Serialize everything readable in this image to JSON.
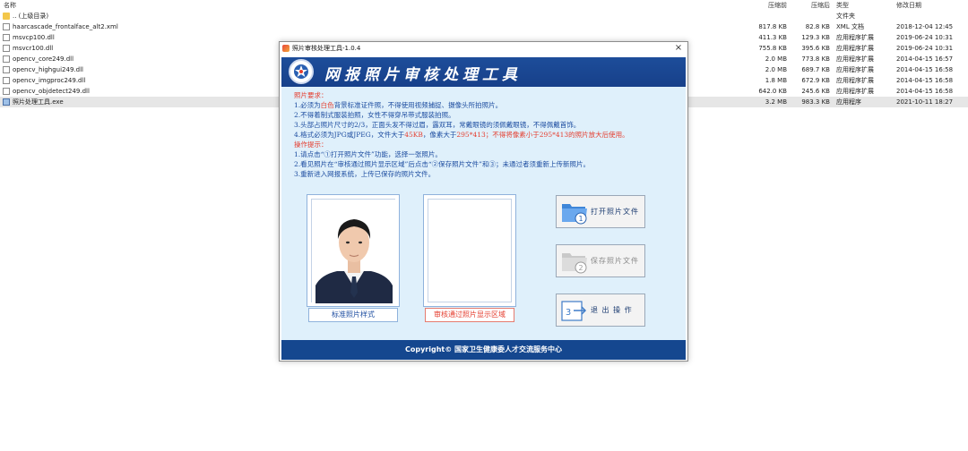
{
  "filelist": {
    "headers": {
      "name": "名称",
      "compressed": "压缩前",
      "original": "压缩后",
      "type": "类型",
      "modified": "修改日期"
    },
    "rows": [
      {
        "name": ".. (上级目录)",
        "compressed": "",
        "original": "",
        "type": "文件夹",
        "modified": "",
        "icon": "folder"
      },
      {
        "name": "haarcascade_frontalface_alt2.xml",
        "compressed": "817.8 KB",
        "original": "82.8 KB",
        "type": "XML 文档",
        "modified": "2018-12-04 12:45",
        "icon": "doc"
      },
      {
        "name": "msvcp100.dll",
        "compressed": "411.3 KB",
        "original": "129.3 KB",
        "type": "应用程序扩展",
        "modified": "2019-06-24 10:31",
        "icon": "doc"
      },
      {
        "name": "msvcr100.dll",
        "compressed": "755.8 KB",
        "original": "395.6 KB",
        "type": "应用程序扩展",
        "modified": "2019-06-24 10:31",
        "icon": "doc"
      },
      {
        "name": "opencv_core249.dll",
        "compressed": "2.0 MB",
        "original": "773.8 KB",
        "type": "应用程序扩展",
        "modified": "2014-04-15 16:57",
        "icon": "doc"
      },
      {
        "name": "opencv_highgui249.dll",
        "compressed": "2.0 MB",
        "original": "689.7 KB",
        "type": "应用程序扩展",
        "modified": "2014-04-15 16:58",
        "icon": "doc"
      },
      {
        "name": "opencv_imgproc249.dll",
        "compressed": "1.8 MB",
        "original": "672.9 KB",
        "type": "应用程序扩展",
        "modified": "2014-04-15 16:58",
        "icon": "doc"
      },
      {
        "name": "opencv_objdetect249.dll",
        "compressed": "642.0 KB",
        "original": "245.6 KB",
        "type": "应用程序扩展",
        "modified": "2014-04-15 16:58",
        "icon": "doc"
      },
      {
        "name": "照片处理工具.exe",
        "compressed": "3.2 MB",
        "original": "983.3 KB",
        "type": "应用程序",
        "modified": "2021-10-11 18:27",
        "icon": "exe",
        "selected": true
      }
    ]
  },
  "dialog": {
    "title": "照片审核处理工具-1.0.4",
    "close_glyph": "×",
    "banner_title": "网报照片审核处理工具",
    "instructions": {
      "req_heading": "照片要求：",
      "r1a": "1.必须为",
      "r1b": "白色",
      "r1c": "背景标准证件照，不得使用视频捕捉、摄像头所拍照片。",
      "r2": "2.不得着制式服装拍照，女性不得穿吊带式服装拍照。",
      "r3": "3.头部占照片尺寸的2/3，正面头发不得过眉，露双耳，常戴眼镜的须佩戴眼镜，不得佩戴首饰。",
      "r4a": "4.格式必须为JPG或JPEG，文件大于",
      "r4b": "45KB",
      "r4c": "，像素大于",
      "r4d": "295*413",
      "r4e": "；不得将像素小于295*413的照片放大后使用。",
      "op_heading": "操作提示：",
      "o1": "1.请点击“①打开照片文件”功能，选择一张照片。",
      "o2": "2.看见照片在“审核通过照片显示区域”后点击“②保存照片文件”和③；未通过者须重新上传新照片。",
      "o3": "3.重新进入网报系统，上传已保存的照片文件。"
    },
    "sample_caption": "标准照片样式",
    "approved_caption": "审核通过照片显示区域",
    "buttons": {
      "open": {
        "number": "1",
        "label": "打开照片文件"
      },
      "save": {
        "number": "2",
        "label": "保存照片文件"
      },
      "exit": {
        "number": "3",
        "label": "退 出 操 作"
      }
    },
    "footer": "Copyright© 国家卫生健康委人才交流服务中心"
  },
  "colors": {
    "banner": "#1d4d9a",
    "footer": "#15478f",
    "panel": "#dff0fb",
    "accent_red": "#e53e2f",
    "text_blue": "#1d4da0"
  },
  "icons": [
    "folder-icon",
    "file-icon",
    "exe-icon",
    "app-icon",
    "close-icon",
    "logo-icon",
    "folder-open-icon",
    "folder-save-icon",
    "exit-arrow-icon"
  ]
}
